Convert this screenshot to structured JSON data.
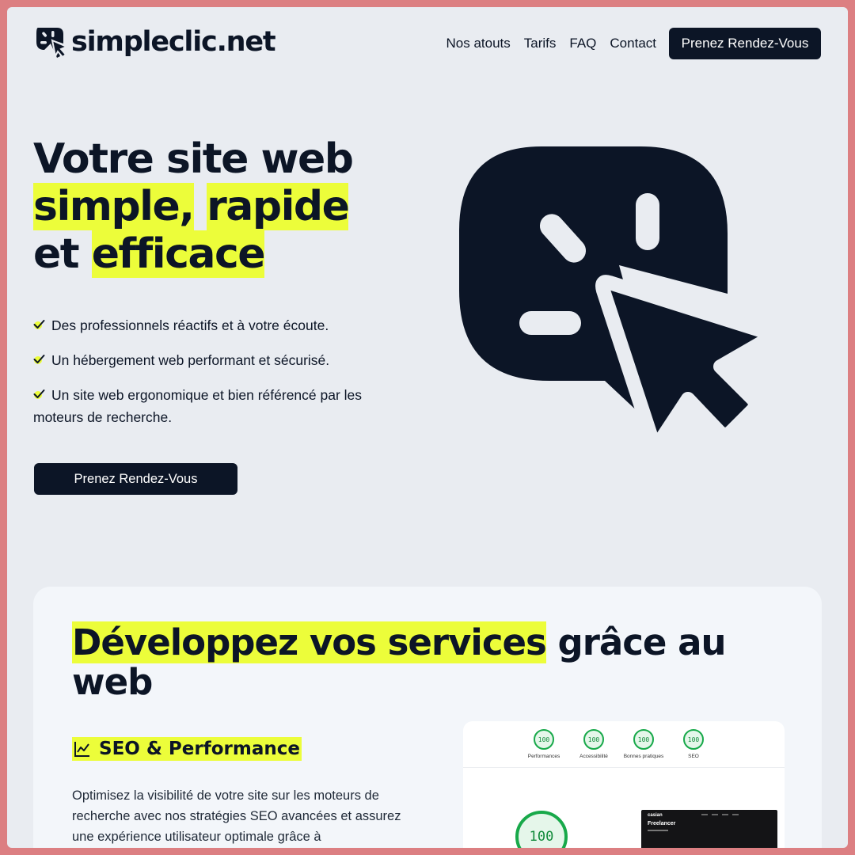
{
  "header": {
    "logo_text": "simpleclic.net",
    "nav": [
      "Nos atouts",
      "Tarifs",
      "FAQ",
      "Contact"
    ],
    "cta_label": "Prenez Rendez-Vous"
  },
  "hero": {
    "title_line1": "Votre site web",
    "title_word_simple": "simple,",
    "title_word_rapide": "rapide",
    "title_word_et": "et",
    "title_word_efficace": "efficace",
    "bullets": [
      "Des professionnels réactifs et à votre écoute.",
      "Un hébergement web performant et sécurisé.",
      "Un site web ergonomique et bien référencé par les moteurs de recherche."
    ],
    "cta_label": "Prenez Rendez-Vous"
  },
  "section": {
    "title_highlight": "Développez vos services",
    "title_rest": "grâce au web",
    "feature_title": "SEO & Performance",
    "feature_text": "Optimisez la visibilité de votre site sur les moteurs de recherche avec nos stratégies SEO avancées et assurez une expérience utilisateur optimale grâce à"
  },
  "lighthouse": {
    "scores": [
      {
        "value": "100",
        "label": "Performances"
      },
      {
        "value": "100",
        "label": "Accessibilité"
      },
      {
        "value": "100",
        "label": "Bonnes pratiques"
      },
      {
        "value": "100",
        "label": "SEO"
      }
    ],
    "main_score": "100",
    "preview_brand": "casian",
    "preview_heading": "Freelancer"
  },
  "colors": {
    "accent": "#ecfd3a",
    "dark": "#0c1526",
    "background": "#e9ecf1",
    "frame_border": "#dc7f82",
    "score_green": "#18a94a"
  },
  "icons": [
    "cursor-click-logo-icon",
    "check-icon",
    "chart-line-icon",
    "cursor-click-hero-icon"
  ]
}
